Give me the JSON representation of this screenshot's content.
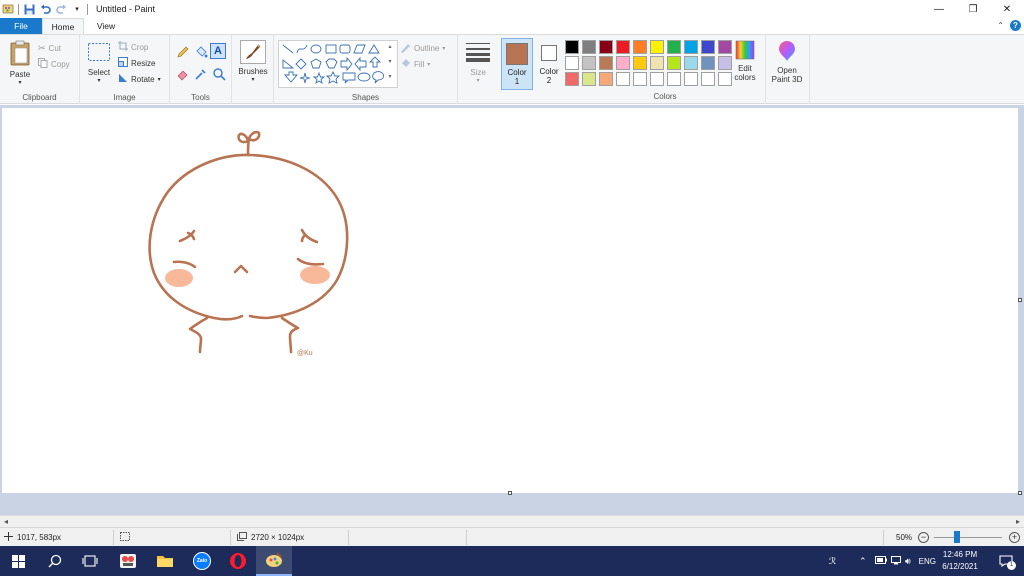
{
  "window": {
    "title": "Untitled - Paint",
    "minimize": "—",
    "restore": "❐",
    "close": "✕"
  },
  "tabs": [
    {
      "label": "File"
    },
    {
      "label": "Home"
    },
    {
      "label": "View"
    }
  ],
  "ribbon": {
    "clipboard": {
      "label": "Clipboard",
      "paste": "Paste",
      "cut": "Cut",
      "copy": "Copy"
    },
    "image": {
      "label": "Image",
      "select": "Select",
      "crop": "Crop",
      "resize": "Resize",
      "rotate": "Rotate"
    },
    "tools": {
      "label": "Tools"
    },
    "brushes": {
      "label": "Brushes"
    },
    "shapes": {
      "label": "Shapes",
      "outline": "Outline",
      "fill": "Fill"
    },
    "size": {
      "label": "Size"
    },
    "color1": {
      "label": "Color",
      "num": "1",
      "value": "#b87352"
    },
    "color2": {
      "label": "Color",
      "num": "2",
      "value": "#ffffff"
    },
    "colors": {
      "label": "Colors",
      "edit_line1": "Edit",
      "edit_line2": "colors"
    },
    "paint3d": {
      "line1": "Open",
      "line2": "Paint 3D"
    }
  },
  "palette": [
    "#000000",
    "#7f7f7f",
    "#880015",
    "#ed1c24",
    "#ff7f27",
    "#fff200",
    "#22b14c",
    "#00a2e8",
    "#3f48cc",
    "#a349a4",
    "#ffffff",
    "#c3c3c3",
    "#b97a57",
    "#ffaec9",
    "#ffc90e",
    "#efe4b0",
    "#b5e61d",
    "#99d9ea",
    "#7092be",
    "#c8bfe7",
    "#f06a6a",
    "#d9e68a",
    "#f5a878",
    "#ffffff",
    "#ffffff",
    "#ffffff",
    "#ffffff",
    "#ffffff",
    "#ffffff",
    "#ffffff"
  ],
  "drawing": {
    "stroke": "#b87352",
    "blush": "#f7b99a",
    "signature": "@Ku"
  },
  "status": {
    "cursor_pos": "1017, 583px",
    "dimensions": "2720 × 1024px",
    "zoom": "50%",
    "zoom_level": 0.5
  },
  "taskbar": {
    "language": "ENG",
    "time": "12:46 PM",
    "date": "6/12/2021",
    "notifications": "1",
    "zalo": "Zalo"
  }
}
